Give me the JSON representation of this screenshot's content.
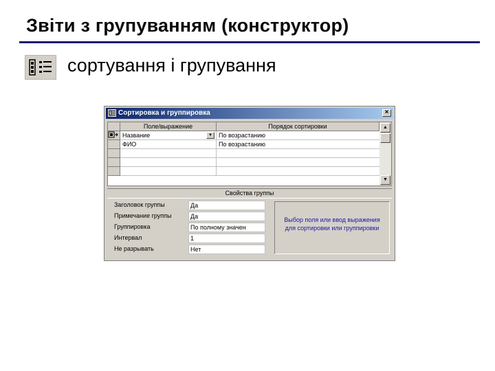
{
  "slide": {
    "title": "Звіти з групуванням (конструктор)",
    "subtitle": "сортування і групування",
    "bullet_icon": "sorting-grouping-icon"
  },
  "dialog": {
    "title": "Сортировка и группировка",
    "close_label": "×",
    "columns": [
      "Поле/выражение",
      "Порядок сортировки"
    ],
    "rows": [
      {
        "field": "Название",
        "order": "По возрастанию",
        "active": true
      },
      {
        "field": "ФИО",
        "order": "По возрастанию",
        "active": false
      },
      {
        "field": "",
        "order": "",
        "active": false
      },
      {
        "field": "",
        "order": "",
        "active": false
      },
      {
        "field": "",
        "order": "",
        "active": false
      }
    ],
    "group_properties_header": "Свойства группы",
    "properties": [
      {
        "label": "Заголовок группы",
        "value": "Да"
      },
      {
        "label": "Примечание группы",
        "value": "Да"
      },
      {
        "label": "Группировка",
        "value": "По полному значен"
      },
      {
        "label": "Интервал",
        "value": "1"
      },
      {
        "label": "Не разрывать",
        "value": "Нет"
      }
    ],
    "hint": "Выбор поля или ввод выражения для сортировки или группировки",
    "colors": {
      "titlebar": "#0a246a",
      "window": "#d4d0c8",
      "hint_text": "#1a1aa0"
    }
  }
}
